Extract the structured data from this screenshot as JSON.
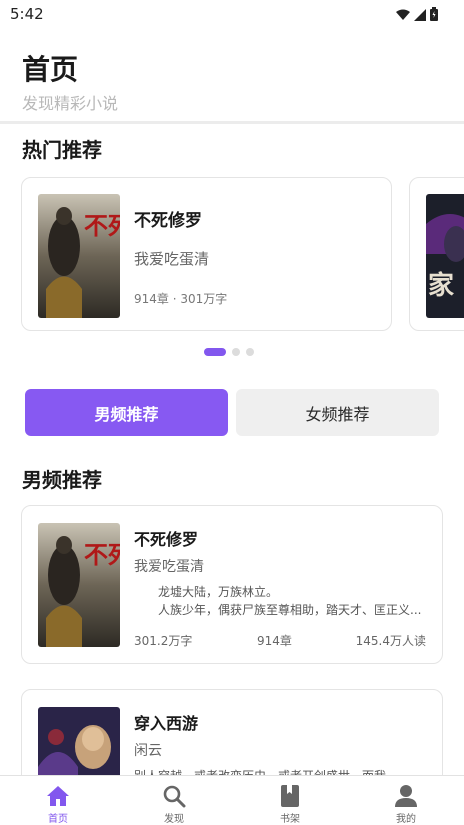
{
  "status_bar": {
    "time": "5:42"
  },
  "header": {
    "title": "首页",
    "subtitle": "发现精彩小说"
  },
  "hot_section": {
    "title": "热门推荐",
    "cards": [
      {
        "title": "不死修罗",
        "author": "我爱吃蛋清",
        "meta": "914章 · 301万字",
        "cover_text": "不死修罗"
      },
      {
        "cover_text": "家"
      }
    ],
    "carousel_dots": 3,
    "carousel_active": 0
  },
  "tabs": {
    "male": "男频推荐",
    "female": "女频推荐",
    "active": "male"
  },
  "list_section": {
    "title": "男频推荐",
    "books": [
      {
        "title": "不死修罗",
        "author": "我爱吃蛋清",
        "desc_line1": "龙墟大陆，万族林立。",
        "desc_line2": "人族少年，偶获尸族至尊相助，踏天才、匡正义...",
        "words": "301.2万字",
        "chapters": "914章",
        "readers": "145.4万人读"
      },
      {
        "title": "穿入西游",
        "author": "闲云",
        "desc_line1": "别人穿越，或者改变历史，或者开创盛世，而我..."
      }
    ]
  },
  "bottom_nav": {
    "items": [
      {
        "label": "首页",
        "icon": "home-icon"
      },
      {
        "label": "发现",
        "icon": "search-icon"
      },
      {
        "label": "书架",
        "icon": "bookshelf-icon"
      },
      {
        "label": "我的",
        "icon": "profile-icon"
      }
    ],
    "active": 0
  },
  "colors": {
    "accent": "#8257ee",
    "tab_active": "#8759f2",
    "muted": "#b8b8b8"
  }
}
